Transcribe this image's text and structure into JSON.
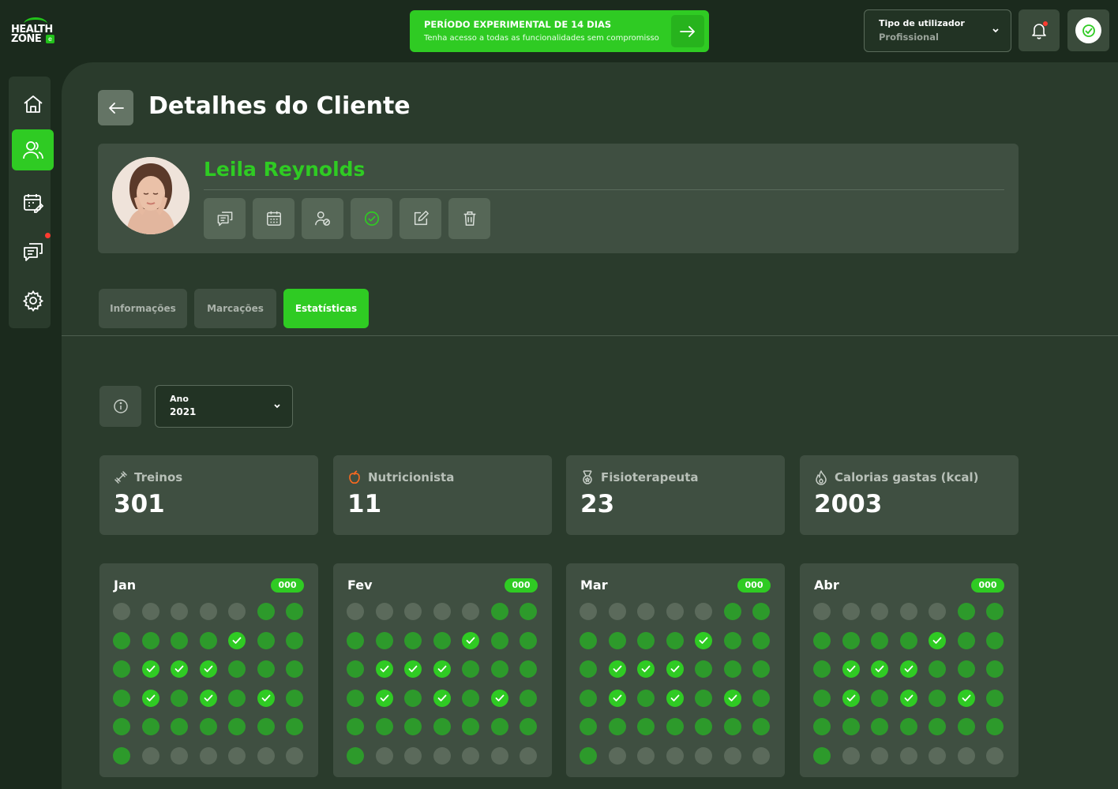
{
  "logo": {
    "line1": "HEALTH",
    "line2": "ZONE",
    "mark": "e"
  },
  "trial": {
    "title": "PERÍODO EXPERIMENTAL DE 14 DIAS",
    "subtitle": "Tenha acesso a todas as funcionalidades sem compromisso",
    "icon": "arrow-right-icon"
  },
  "user_type": {
    "label": "Tipo de utilizador",
    "value": "Profissional"
  },
  "notifications": {
    "has_unread": true
  },
  "sidebar": {
    "items": [
      {
        "name": "home",
        "icon": "home-icon",
        "active": false
      },
      {
        "name": "clients",
        "icon": "users-icon",
        "active": true
      },
      {
        "name": "calendar",
        "icon": "calendar-edit-icon",
        "active": false
      },
      {
        "name": "messages",
        "icon": "chat-icon",
        "active": false,
        "badge": true
      },
      {
        "name": "settings",
        "icon": "gear-icon",
        "active": false
      }
    ]
  },
  "page": {
    "title": "Detalhes do Cliente"
  },
  "client": {
    "name": "Leila Reynolds",
    "actions": [
      {
        "name": "messages",
        "icon": "chat-icon"
      },
      {
        "name": "calendar",
        "icon": "calendar-icon"
      },
      {
        "name": "assign",
        "icon": "user-assign-icon"
      },
      {
        "name": "approve",
        "icon": "check-circle-icon"
      },
      {
        "name": "edit",
        "icon": "edit-icon"
      },
      {
        "name": "delete",
        "icon": "trash-icon"
      }
    ]
  },
  "tabs": [
    {
      "label": "Informações",
      "active": false
    },
    {
      "label": "Marcações",
      "active": false
    },
    {
      "label": "Estatísticas",
      "active": true
    }
  ],
  "filter": {
    "label": "Ano",
    "value": "2021"
  },
  "stats": [
    {
      "label": "Treinos",
      "value": "301",
      "icon": "dumbbell-icon"
    },
    {
      "label": "Nutricionista",
      "value": "11",
      "icon": "apple-icon"
    },
    {
      "label": "Fisioterapeuta",
      "value": "23",
      "icon": "medal-icon"
    },
    {
      "label": "Calorias gastas (kcal)",
      "value": "2003",
      "icon": "flame-icon"
    }
  ],
  "months": [
    {
      "name": "Jan",
      "badge": "000",
      "rows": [
        "eeeeeaa",
        "aaaacaa",
        "acccaaa",
        "acacaca",
        "aaaaaaa",
        "aeeeeee"
      ]
    },
    {
      "name": "Fev",
      "badge": "000",
      "rows": [
        "eeeeeaa",
        "aaaacaa",
        "acccaaa",
        "acacaca",
        "aaaaaaa",
        "aeeeeee"
      ]
    },
    {
      "name": "Mar",
      "badge": "000",
      "rows": [
        "eeeeeaa",
        "aaaacaa",
        "acccaaa",
        "acacaca",
        "aaaaaaa",
        "aeeeeee"
      ]
    },
    {
      "name": "Abr",
      "badge": "000",
      "rows": [
        "eeeeeaa",
        "aaaacaa",
        "acccaaa",
        "acacaca",
        "aaaaaaa",
        "aeeeeee"
      ]
    }
  ],
  "colors": {
    "accent": "#2fcb23",
    "background": "#1b2a1d",
    "panel": "#2a3b2c",
    "card": "#3f4f41"
  }
}
